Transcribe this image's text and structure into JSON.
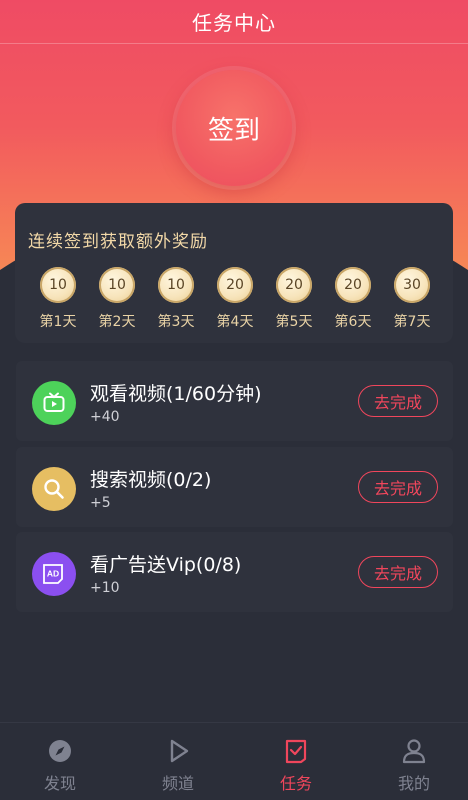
{
  "header": {
    "title": "任务中心"
  },
  "sign_in": {
    "label": "签到"
  },
  "streak": {
    "heading": "连续签到获取额外奖励",
    "days": [
      {
        "points": "10",
        "label": "第1天"
      },
      {
        "points": "10",
        "label": "第2天"
      },
      {
        "points": "10",
        "label": "第3天"
      },
      {
        "points": "20",
        "label": "第4天"
      },
      {
        "points": "20",
        "label": "第5天"
      },
      {
        "points": "20",
        "label": "第6天"
      },
      {
        "points": "30",
        "label": "第7天"
      }
    ]
  },
  "tasks": [
    {
      "name": "观看视频(1/60分钟)",
      "reward": "+40",
      "action": "去完成",
      "icon": "tv-play-icon",
      "color": "#4dd25a"
    },
    {
      "name": "搜索视频(0/2)",
      "reward": "+5",
      "action": "去完成",
      "icon": "search-icon",
      "color": "#e6be62"
    },
    {
      "name": "看广告送Vip(0/8)",
      "reward": "+10",
      "action": "去完成",
      "icon": "ad-icon",
      "color": "#8b4ff0"
    }
  ],
  "tabbar": {
    "items": [
      {
        "label": "发现",
        "icon": "compass-icon",
        "active": false
      },
      {
        "label": "频道",
        "icon": "play-icon",
        "active": false
      },
      {
        "label": "任务",
        "icon": "task-check-icon",
        "active": true
      },
      {
        "label": "我的",
        "icon": "user-icon",
        "active": false
      }
    ]
  },
  "colors": {
    "accent": "#f0465c",
    "gold_text": "#f3d9a8",
    "card_bg": "#2f323d",
    "page_bg": "#2b2e39"
  }
}
